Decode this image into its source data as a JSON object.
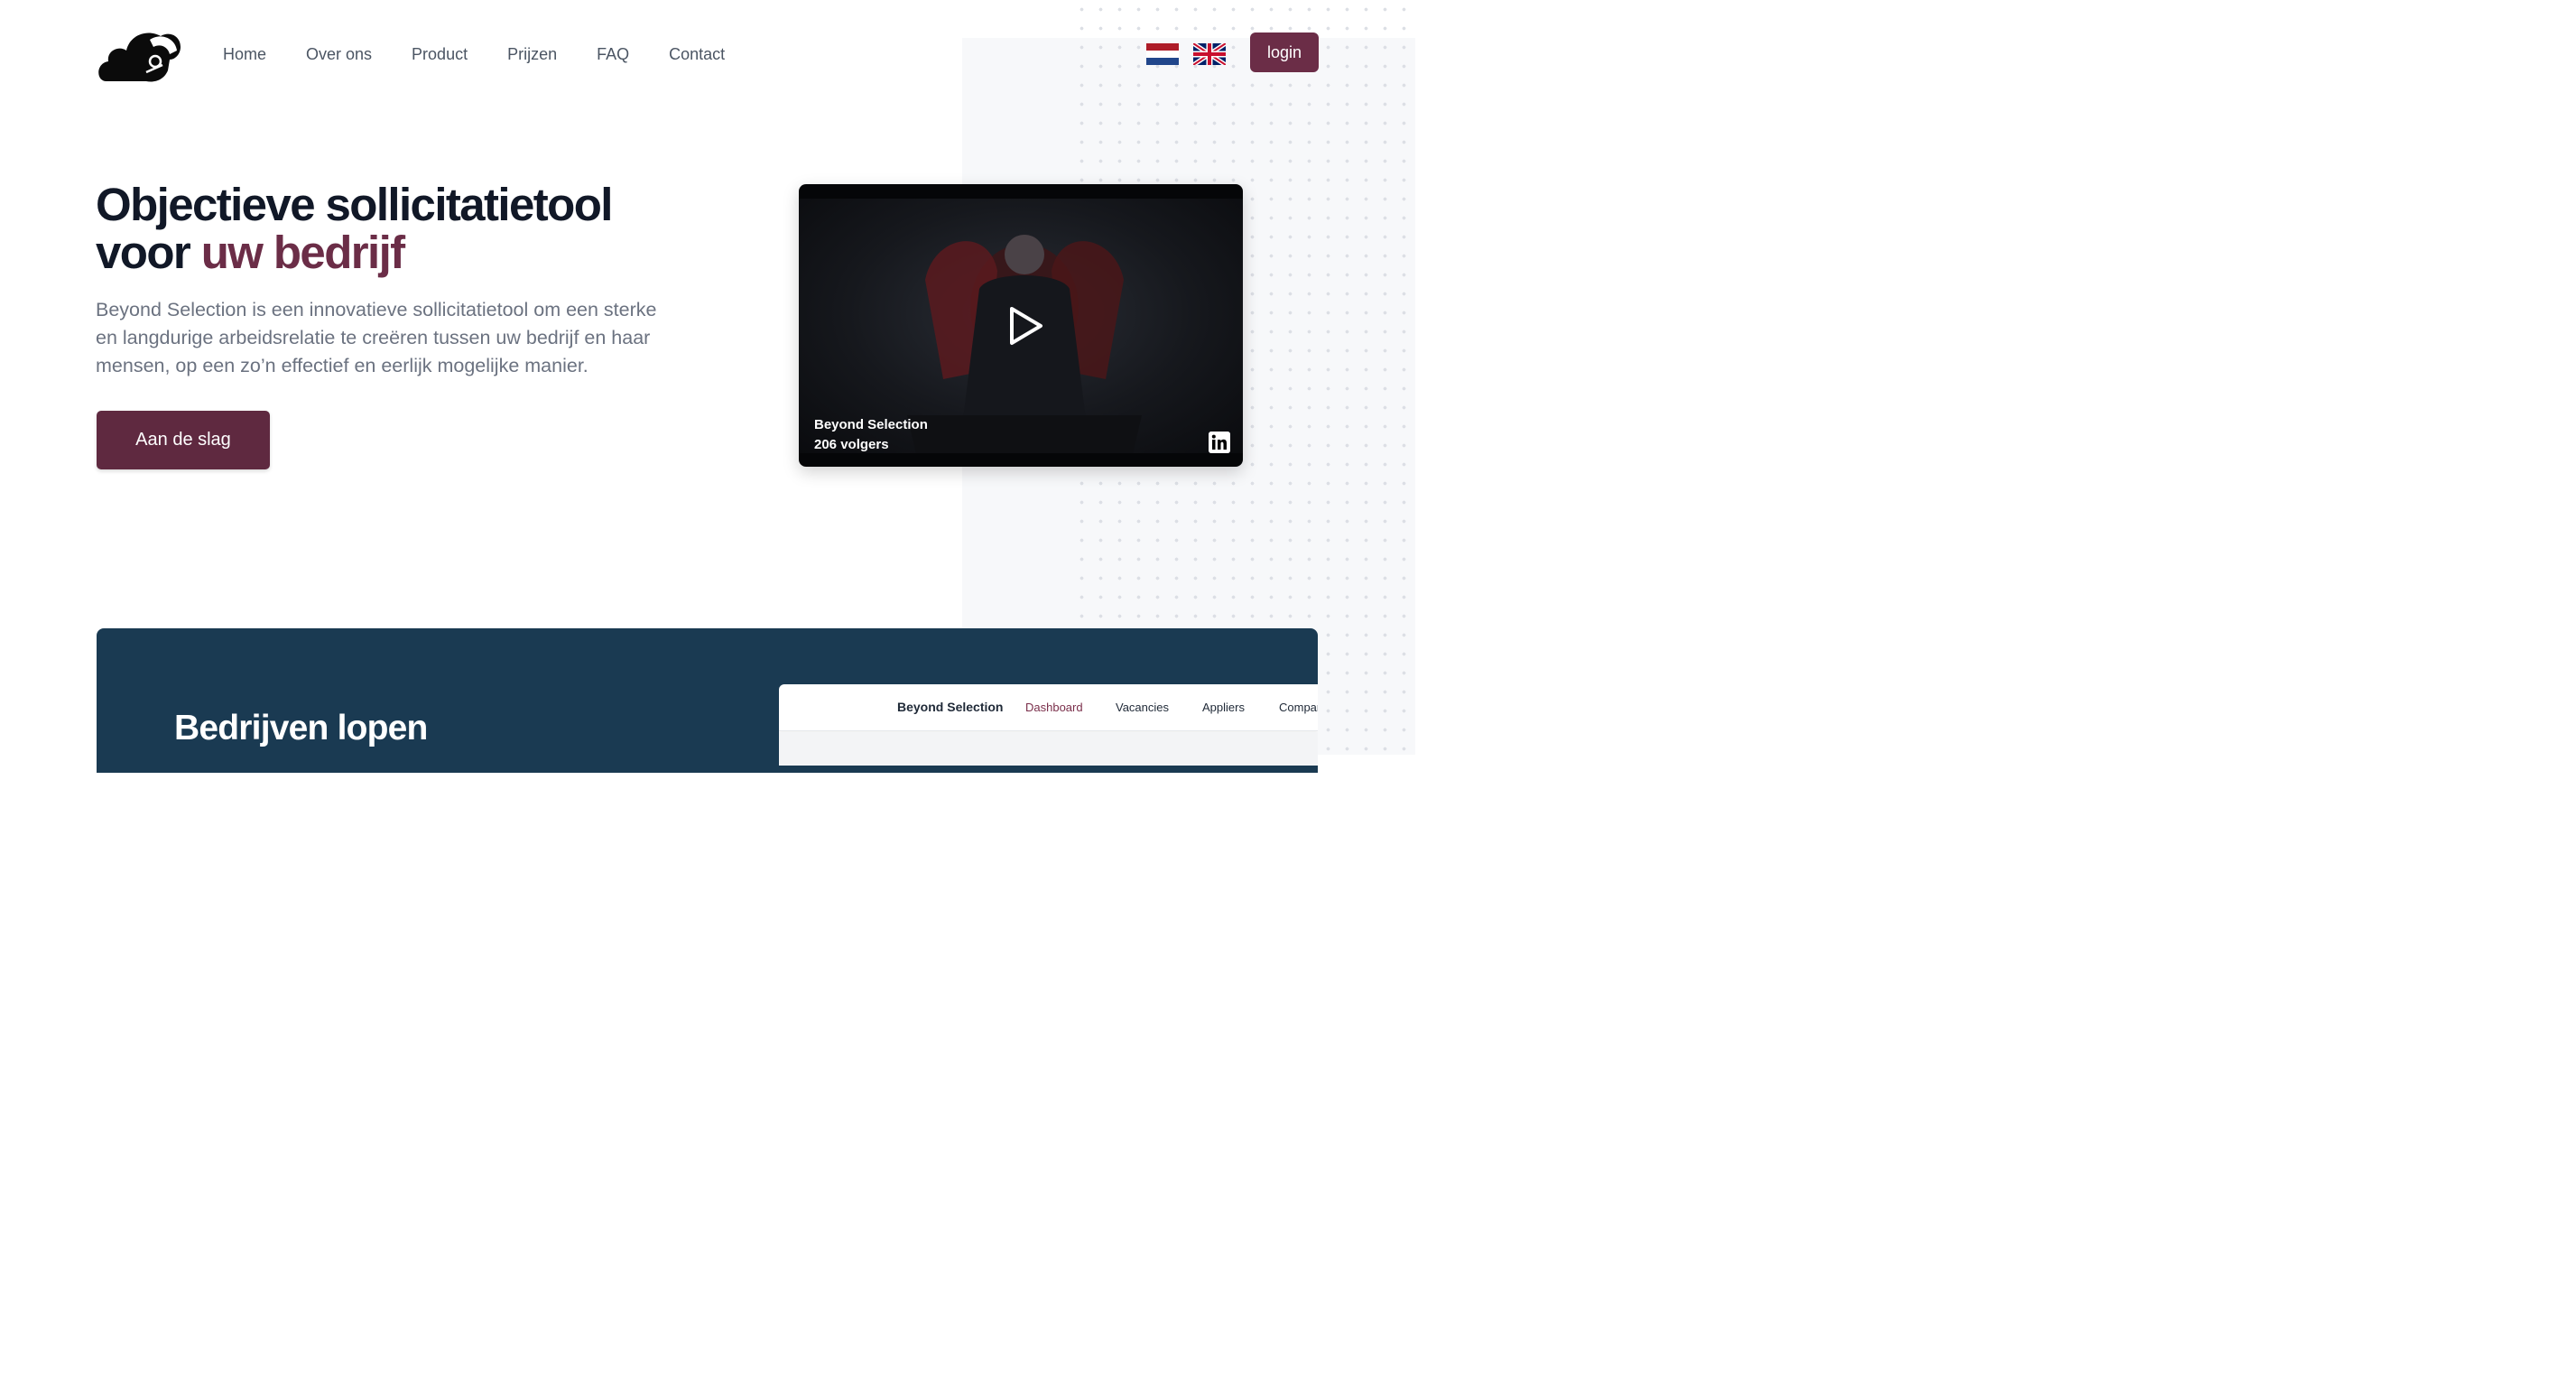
{
  "nav": {
    "items": [
      {
        "label": "Home"
      },
      {
        "label": "Over ons"
      },
      {
        "label": "Product"
      },
      {
        "label": "Prijzen"
      },
      {
        "label": "FAQ"
      },
      {
        "label": "Contact"
      }
    ],
    "login_label": "login",
    "languages": [
      "nl-flag-icon",
      "uk-flag-icon"
    ]
  },
  "hero": {
    "title_line1": "Objectieve sollicitatietool",
    "title_line2_plain": "voor ",
    "title_line2_accent": "uw bedrijf",
    "text": "Beyond Selection is een innovatieve sollicitatietool om een sterke en langdurige arbeidsrelatie te creëren tussen uw bedrijf en haar mensen, op een zo’n effectief en eerlijk mogelijke manier.",
    "cta_label": "Aan de slag"
  },
  "video": {
    "name": "Beyond Selection",
    "followers": "206 volgers"
  },
  "section": {
    "title": "Bedrijven lopen"
  },
  "app_preview": {
    "brand": "Beyond Selection",
    "tabs": [
      "Dashboard",
      "Vacancies",
      "Appliers",
      "Compar"
    ]
  },
  "colors": {
    "brand": "#6b2d47",
    "cta": "#5f2940",
    "band": "#1a3a52",
    "text_muted": "#6b7280"
  }
}
